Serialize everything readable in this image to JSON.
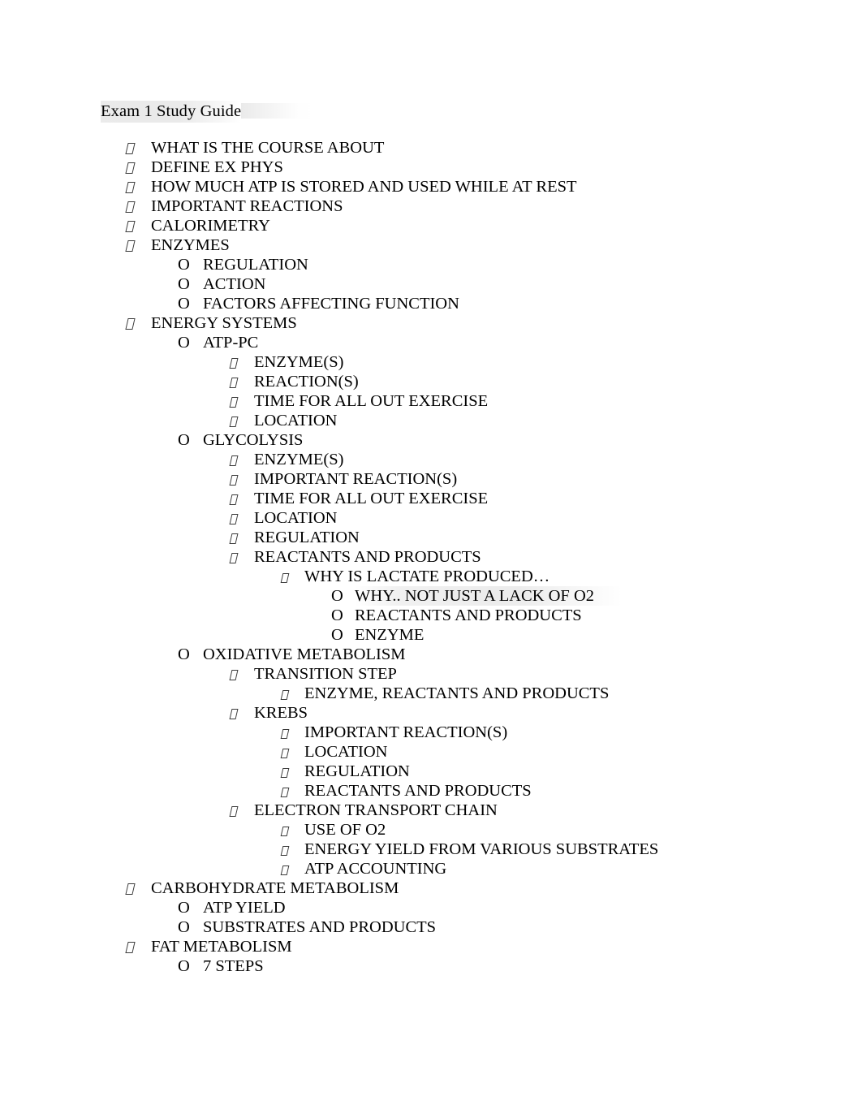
{
  "document": {
    "title": "Exam 1 Study Guide",
    "bullet_glyphs": {
      "level_odd": "missing-glyph-box",
      "level_even": "O"
    },
    "highlight_color": "#e6e6e6",
    "text_color": "#000000",
    "page_background": "#ffffff"
  },
  "outline": [
    {
      "level": 1,
      "bullet": "missing-glyph-box",
      "text": "WHAT IS THE COURSE ABOUT",
      "highlighted": false
    },
    {
      "level": 1,
      "bullet": "missing-glyph-box",
      "text": "DEFINE EX PHYS",
      "highlighted": false
    },
    {
      "level": 1,
      "bullet": "missing-glyph-box",
      "text": "HOW MUCH ATP IS STORED AND USED WHILE AT REST",
      "highlighted": false
    },
    {
      "level": 1,
      "bullet": "missing-glyph-box",
      "text": "IMPORTANT REACTIONS",
      "highlighted": false
    },
    {
      "level": 1,
      "bullet": "missing-glyph-box",
      "text": "CALORIMETRY",
      "highlighted": false
    },
    {
      "level": 1,
      "bullet": "missing-glyph-box",
      "text": "ENZYMES",
      "highlighted": false
    },
    {
      "level": 2,
      "bullet": "O",
      "text": "REGULATION",
      "highlighted": false
    },
    {
      "level": 2,
      "bullet": "O",
      "text": "ACTION",
      "highlighted": false
    },
    {
      "level": 2,
      "bullet": "O",
      "text": "FACTORS AFFECTING FUNCTION",
      "highlighted": false
    },
    {
      "level": 1,
      "bullet": "missing-glyph-box",
      "text": "ENERGY SYSTEMS",
      "highlighted": false
    },
    {
      "level": 2,
      "bullet": "O",
      "text": "ATP-PC",
      "highlighted": false
    },
    {
      "level": 3,
      "bullet": "missing-glyph-box",
      "text": "ENZYME(S)",
      "highlighted": false
    },
    {
      "level": 3,
      "bullet": "missing-glyph-box",
      "text": "REACTION(S)",
      "highlighted": false
    },
    {
      "level": 3,
      "bullet": "missing-glyph-box",
      "text": "TIME FOR ALL OUT EXERCISE",
      "highlighted": false
    },
    {
      "level": 3,
      "bullet": "missing-glyph-box",
      "text": "LOCATION",
      "highlighted": false
    },
    {
      "level": 2,
      "bullet": "O",
      "text": "GLYCOLYSIS",
      "highlighted": false
    },
    {
      "level": 3,
      "bullet": "missing-glyph-box",
      "text": "ENZYME(S)",
      "highlighted": false
    },
    {
      "level": 3,
      "bullet": "missing-glyph-box",
      "text": "IMPORTANT REACTION(S)",
      "highlighted": false
    },
    {
      "level": 3,
      "bullet": "missing-glyph-box",
      "text": "TIME FOR ALL OUT EXERCISE",
      "highlighted": false
    },
    {
      "level": 3,
      "bullet": "missing-glyph-box",
      "text": "LOCATION",
      "highlighted": false
    },
    {
      "level": 3,
      "bullet": "missing-glyph-box",
      "text": "REGULATION",
      "highlighted": false
    },
    {
      "level": 3,
      "bullet": "missing-glyph-box",
      "text": "REACTANTS AND PRODUCTS",
      "highlighted": false
    },
    {
      "level": 6,
      "bullet": "missing-glyph-box",
      "text": "WHY IS LACTATE PRODUCED…",
      "highlighted": false
    },
    {
      "level": 4,
      "bullet": "O",
      "text": "WHY.. NOT JUST A LACK OF O2",
      "highlighted": true
    },
    {
      "level": 4,
      "bullet": "O",
      "text": "REACTANTS AND PRODUCTS",
      "highlighted": false
    },
    {
      "level": 4,
      "bullet": "O",
      "text": "ENZYME",
      "highlighted": false
    },
    {
      "level": 2,
      "bullet": "O",
      "text": "OXIDATIVE METABOLISM",
      "highlighted": false
    },
    {
      "level": 3,
      "bullet": "missing-glyph-box",
      "text": "TRANSITION STEP",
      "highlighted": false
    },
    {
      "level": 5,
      "bullet": "missing-glyph-box",
      "text": "ENZYME, REACTANTS AND PRODUCTS",
      "highlighted": false
    },
    {
      "level": 3,
      "bullet": "missing-glyph-box",
      "text": "KREBS",
      "highlighted": false
    },
    {
      "level": 5,
      "bullet": "missing-glyph-box",
      "text": "IMPORTANT REACTION(S)",
      "highlighted": false
    },
    {
      "level": 5,
      "bullet": "missing-glyph-box",
      "text": "LOCATION",
      "highlighted": false
    },
    {
      "level": 5,
      "bullet": "missing-glyph-box",
      "text": "REGULATION",
      "highlighted": false
    },
    {
      "level": 5,
      "bullet": "missing-glyph-box",
      "text": "REACTANTS AND PRODUCTS",
      "highlighted": false
    },
    {
      "level": 3,
      "bullet": "missing-glyph-box",
      "text": "ELECTRON TRANSPORT CHAIN",
      "highlighted": false
    },
    {
      "level": 5,
      "bullet": "missing-glyph-box",
      "text": "USE OF O2",
      "highlighted": false
    },
    {
      "level": 5,
      "bullet": "missing-glyph-box",
      "text": "ENERGY YIELD FROM VARIOUS SUBSTRATES",
      "highlighted": false
    },
    {
      "level": 5,
      "bullet": "missing-glyph-box",
      "text": "ATP ACCOUNTING",
      "highlighted": false
    },
    {
      "level": 1,
      "bullet": "missing-glyph-box",
      "text": "CARBOHYDRATE METABOLISM",
      "highlighted": false
    },
    {
      "level": 2,
      "bullet": "O",
      "text": "ATP YIELD",
      "highlighted": false
    },
    {
      "level": 2,
      "bullet": "O",
      "text": "SUBSTRATES AND PRODUCTS",
      "highlighted": false
    },
    {
      "level": 1,
      "bullet": "missing-glyph-box",
      "text": "FAT METABOLISM",
      "highlighted": false
    },
    {
      "level": 2,
      "bullet": "O",
      "text": "7 STEPS",
      "highlighted": false
    }
  ]
}
